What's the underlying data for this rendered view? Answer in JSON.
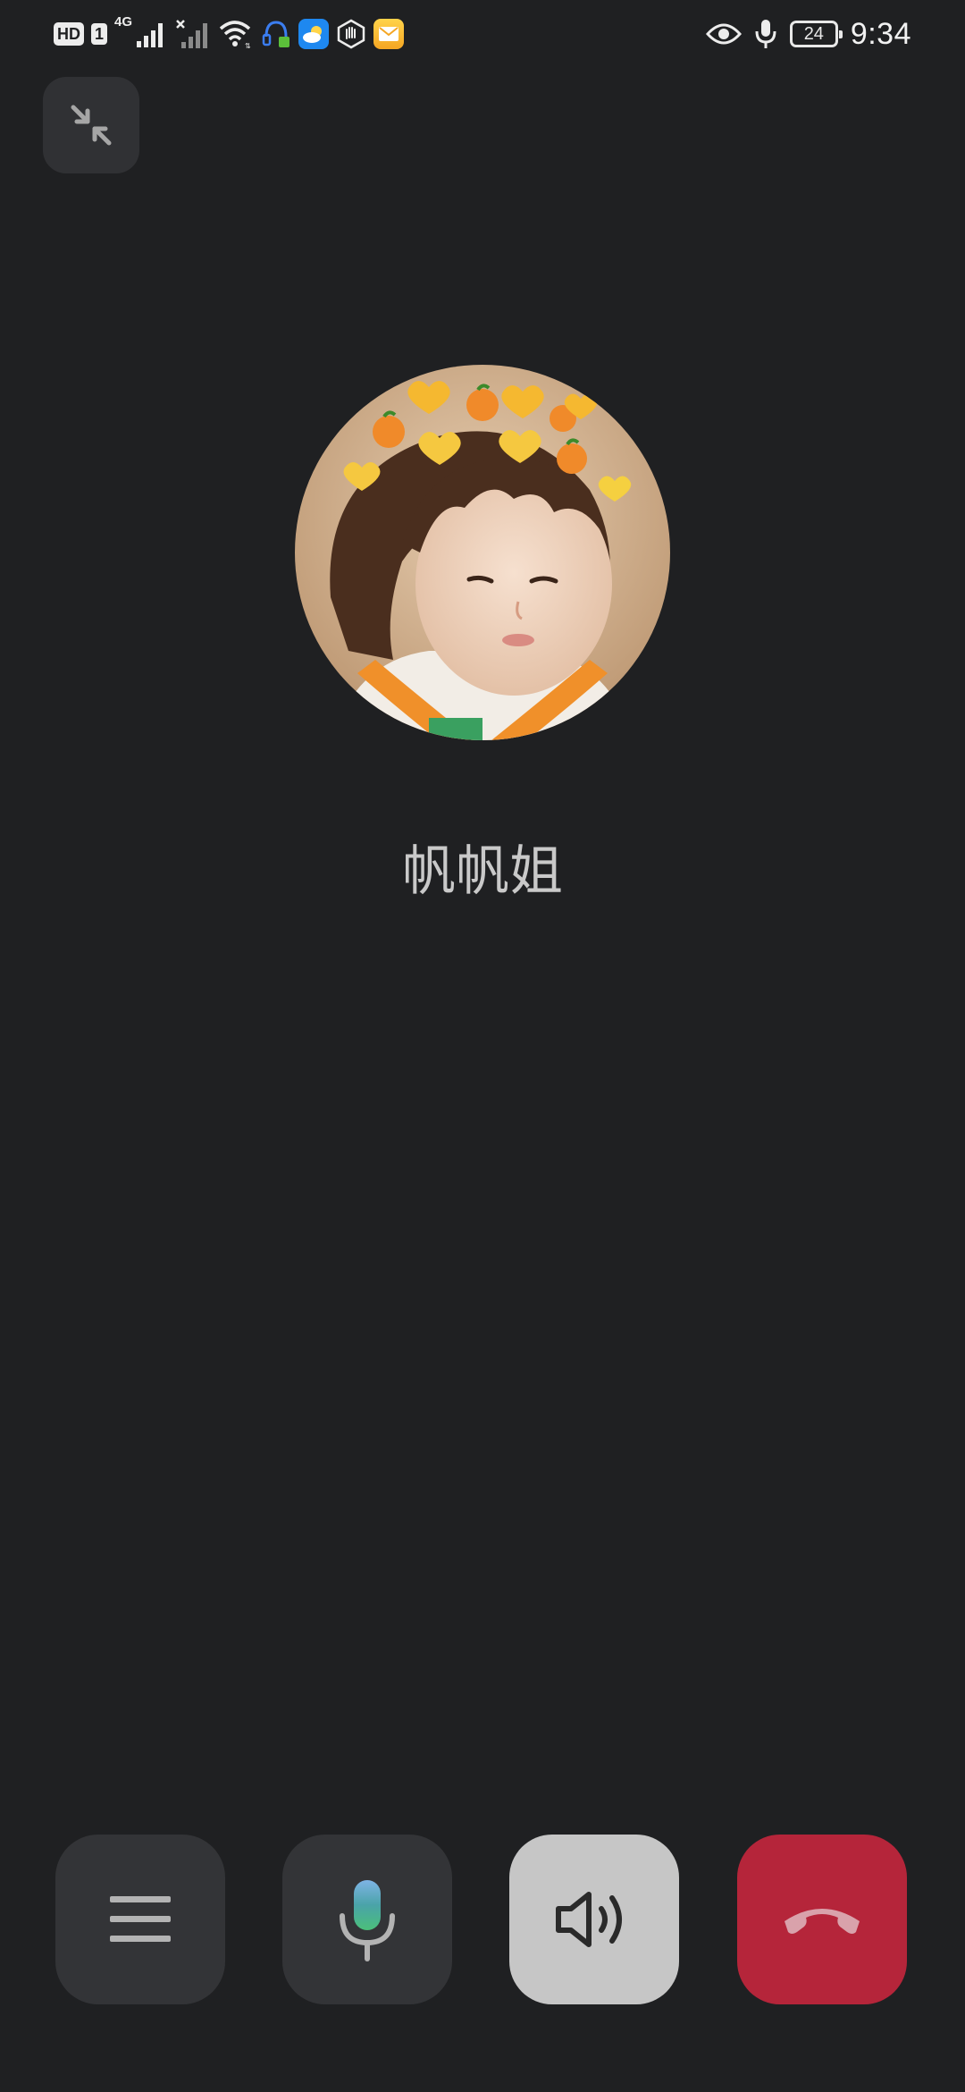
{
  "status_bar": {
    "hd_label": "HD",
    "sim_label": "1",
    "network_label": "4G",
    "battery_level": "24",
    "time": "9:34",
    "icons": [
      "hd-icon",
      "sim-icon",
      "signal-icon",
      "no-signal-icon",
      "wifi-icon",
      "headset-notification-icon",
      "weather-app-icon",
      "hand-app-icon",
      "mail-app-icon",
      "eye-icon",
      "mic-status-icon",
      "battery-icon"
    ]
  },
  "call": {
    "contact_name": "帆帆姐",
    "minimize_icon": "minimize-icon",
    "controls": [
      {
        "name": "menu-button",
        "icon": "menu-icon"
      },
      {
        "name": "mute-button",
        "icon": "microphone-icon"
      },
      {
        "name": "speaker-button",
        "icon": "speaker-icon",
        "active": true
      },
      {
        "name": "hang-up-button",
        "icon": "phone-hangup-icon"
      }
    ]
  },
  "colors": {
    "background": "#1f2022",
    "button": "#333437",
    "speaker_active": "#c6c6c6",
    "hang_up": "#b5253a"
  }
}
